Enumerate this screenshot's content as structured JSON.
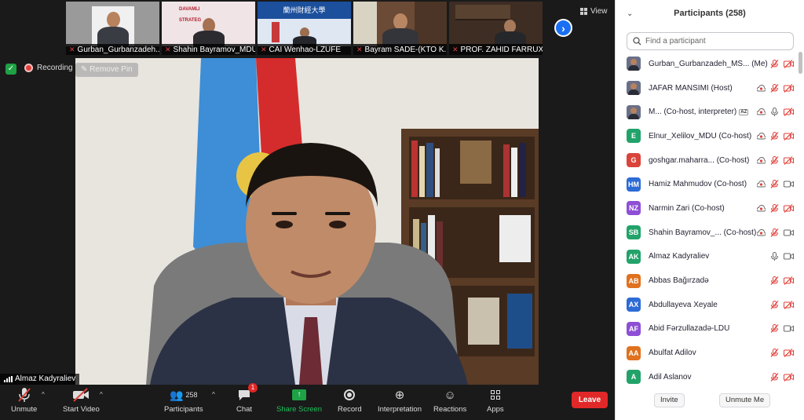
{
  "thumbnails": [
    {
      "name": "Gurban_Gurbanzadeh..."
    },
    {
      "name": "Shahin Bayramov_MDU",
      "banner_lines": [
        "DAVAMLI",
        "STRATEG"
      ]
    },
    {
      "name": "CAI Wenhao-LZUFE",
      "banner": "蘭州財經大學"
    },
    {
      "name": "Bayram SADE-(KTO K..."
    },
    {
      "name": "PROF. ZAHID FARRUX..."
    }
  ],
  "view_label": "View",
  "recording_label": "Recording",
  "remove_pin_label": "Remove Pin",
  "speaker_name": "Almaz Kadyraliev",
  "toolbar": {
    "unmute": "Unmute",
    "start_video": "Start Video",
    "participants": "Participants",
    "participants_count": "258",
    "chat": "Chat",
    "chat_badge": "1",
    "share_screen": "Share Screen",
    "record": "Record",
    "interpretation": "Interpretation",
    "reactions": "Reactions",
    "apps": "Apps",
    "leave": "Leave"
  },
  "panel": {
    "title": "Participants (258)",
    "search_placeholder": "Find a participant",
    "invite": "Invite",
    "unmute_me": "Unmute Me"
  },
  "participants": [
    {
      "name": "Gurban_Gurbanzadeh_MS...",
      "suffix": "(Me)",
      "avatar": "photo",
      "record": false,
      "mic": "off",
      "video": "off"
    },
    {
      "name": "JAFAR MANSIMI (Host)",
      "avatar": "photo",
      "record": true,
      "mic": "off",
      "video": "off"
    },
    {
      "name": "M... (Co-host, interpreter)",
      "tag": "AZ",
      "avatar": "photo",
      "record": true,
      "mic": "on",
      "video": "off"
    },
    {
      "name": "Elnur_Xelilov_MDU (Co-host)",
      "initials": "E",
      "color": "#22a36a",
      "record": true,
      "mic": "off",
      "video": "off"
    },
    {
      "name": "goshgar.maharra... (Co-host)",
      "initials": "G",
      "color": "#d9453b",
      "record": true,
      "mic": "off",
      "video": "off"
    },
    {
      "name": "Hamiz Mahmudov (Co-host)",
      "initials": "HM",
      "color": "#2d6bd6",
      "record": true,
      "mic": "off",
      "video": "on"
    },
    {
      "name": "Narmin Zari (Co-host)",
      "initials": "NZ",
      "color": "#8e4fd6",
      "record": true,
      "mic": "off",
      "video": "off"
    },
    {
      "name": "Shahin Bayramov_... (Co-host)",
      "initials": "SB",
      "color": "#22a36a",
      "record": true,
      "mic": "off",
      "video": "on"
    },
    {
      "name": "Almaz Kadyraliev",
      "initials": "AK",
      "color": "#22a36a",
      "record": false,
      "mic": "on",
      "video": "on"
    },
    {
      "name": "Abbas Bağırzadə",
      "initials": "AB",
      "color": "#e0711e",
      "record": false,
      "mic": "off",
      "video": "off"
    },
    {
      "name": "Abdullayeva Xeyale",
      "initials": "AX",
      "color": "#2d6bd6",
      "record": false,
      "mic": "off",
      "video": "off"
    },
    {
      "name": "Abid Fərzullazadə-LDU",
      "initials": "AF",
      "color": "#8e4fd6",
      "record": false,
      "mic": "off",
      "video": "on"
    },
    {
      "name": "Abulfat Adilov",
      "initials": "AA",
      "color": "#e0711e",
      "record": false,
      "mic": "off",
      "video": "off"
    },
    {
      "name": "Adil Aslanov",
      "initials": "A",
      "color": "#22a36a",
      "record": false,
      "mic": "off",
      "video": "off"
    }
  ],
  "colors": {
    "accent_blue": "#1b6ff2",
    "leave_red": "#e02828",
    "share_green": "#1fa245",
    "muted_red": "#e0413b"
  }
}
